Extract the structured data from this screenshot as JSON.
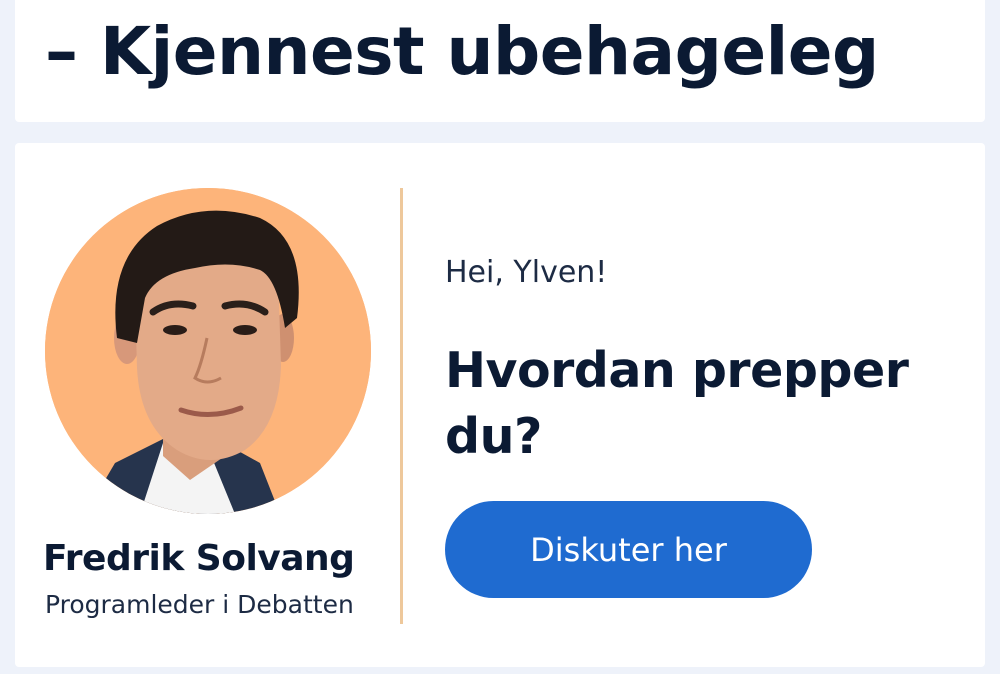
{
  "headline": {
    "title": "– Kjennest ubehageleg"
  },
  "debate_card": {
    "host": {
      "name": "Fredrik Solvang",
      "role": "Programleder i Debatten",
      "avatar_background": "#fdb47a"
    },
    "divider_color": "#eec89b",
    "greeting": "Hei, Ylven!",
    "question": "Hvordan prepper du?",
    "cta": {
      "label": "Diskuter her",
      "color": "#1f6bd0"
    }
  }
}
